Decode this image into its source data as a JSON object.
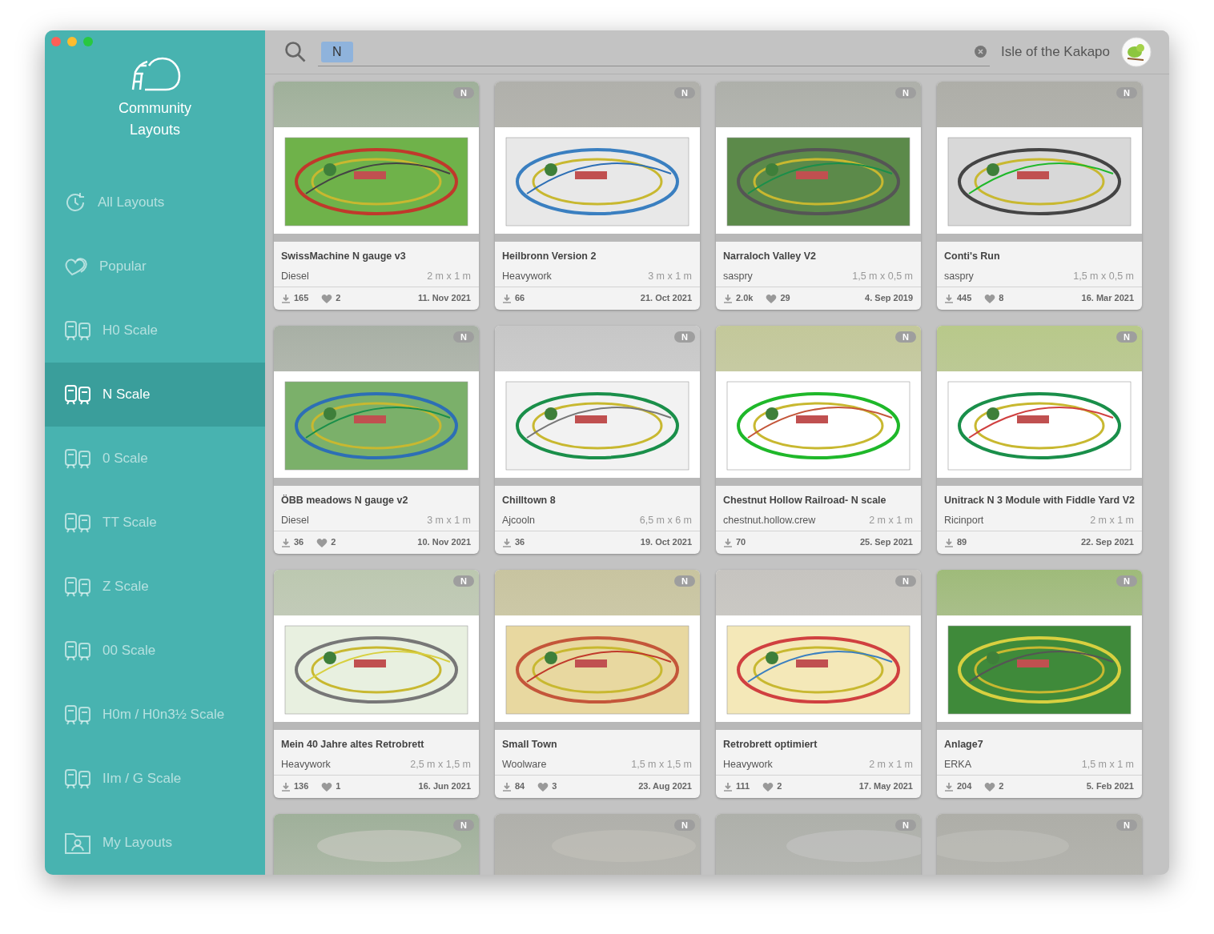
{
  "sidebar": {
    "title": "Community\nLayouts",
    "items": [
      {
        "label": "All Layouts",
        "kind": "recent",
        "selected": false
      },
      {
        "label": "Popular",
        "kind": "popular",
        "selected": false
      },
      {
        "label": "H0 Scale",
        "kind": "scale",
        "selected": false
      },
      {
        "label": "N Scale",
        "kind": "scale",
        "selected": true
      },
      {
        "label": "0 Scale",
        "kind": "scale",
        "selected": false
      },
      {
        "label": "TT Scale",
        "kind": "scale",
        "selected": false
      },
      {
        "label": "Z Scale",
        "kind": "scale",
        "selected": false
      },
      {
        "label": "00 Scale",
        "kind": "scale",
        "selected": false
      },
      {
        "label": "H0m / H0n3½ Scale",
        "kind": "scale",
        "selected": false
      },
      {
        "label": "IIm / G Scale",
        "kind": "scale",
        "selected": false
      },
      {
        "label": "My Layouts",
        "kind": "mine",
        "selected": false
      }
    ]
  },
  "search": {
    "token": "N"
  },
  "user": {
    "name": "Isle of the Kakapo"
  },
  "cards": [
    {
      "badge": "N",
      "title": "SwissMachine N gauge v3",
      "author": "Diesel",
      "size": "2 m x 1 m",
      "downloads": "165",
      "likes": "2",
      "date": "11. Nov 2021"
    },
    {
      "badge": "N",
      "title": "Heilbronn Version 2",
      "author": "Heavywork",
      "size": "3 m x 1 m",
      "downloads": "66",
      "date": "21. Oct 2021"
    },
    {
      "badge": "N",
      "title": "Narraloch Valley V2",
      "author": "saspry",
      "size": "1,5 m x 0,5 m",
      "downloads": "2.0k",
      "likes": "29",
      "date": "4. Sep 2019"
    },
    {
      "badge": "N",
      "title": "Conti's Run",
      "author": "saspry",
      "size": "1,5 m x 0,5 m",
      "downloads": "445",
      "likes": "8",
      "date": "16. Mar 2021"
    },
    {
      "badge": "N",
      "title": "ÖBB meadows N gauge v2",
      "author": "Diesel",
      "size": "3 m x 1 m",
      "downloads": "36",
      "likes": "2",
      "date": "10. Nov 2021"
    },
    {
      "badge": "N",
      "title": "Chilltown 8",
      "author": "Ajcooln",
      "size": "6,5 m x 6 m",
      "downloads": "36",
      "date": "19. Oct 2021"
    },
    {
      "badge": "N",
      "title": "Chestnut Hollow Railroad- N scale",
      "author": "chestnut.hollow.crew",
      "size": "2 m x 1 m",
      "downloads": "70",
      "date": "25. Sep 2021"
    },
    {
      "badge": "N",
      "title": "Unitrack N 3 Module with Fiddle Yard V2",
      "author": "Ricinport",
      "size": "2 m x 1 m",
      "downloads": "89",
      "date": "22. Sep 2021"
    },
    {
      "badge": "N",
      "title": "Mein 40 Jahre altes Retrobrett",
      "author": "Heavywork",
      "size": "2,5 m x 1,5 m",
      "downloads": "136",
      "likes": "1",
      "date": "16. Jun 2021"
    },
    {
      "badge": "N",
      "title": "Small Town",
      "author": "Woolware",
      "size": "1,5 m x 1,5 m",
      "downloads": "84",
      "likes": "3",
      "date": "23. Aug 2021"
    },
    {
      "badge": "N",
      "title": "Retrobrett optimiert",
      "author": "Heavywork",
      "size": "2 m x 1 m",
      "downloads": "111",
      "likes": "2",
      "date": "17. May 2021"
    },
    {
      "badge": "N",
      "title": "Anlage7",
      "author": "ERKA",
      "size": "1,5 m x 1 m",
      "downloads": "204",
      "likes": "2",
      "date": "5. Feb 2021"
    },
    {
      "badge": "N"
    },
    {
      "badge": "N"
    },
    {
      "badge": "N"
    },
    {
      "badge": "N"
    }
  ]
}
